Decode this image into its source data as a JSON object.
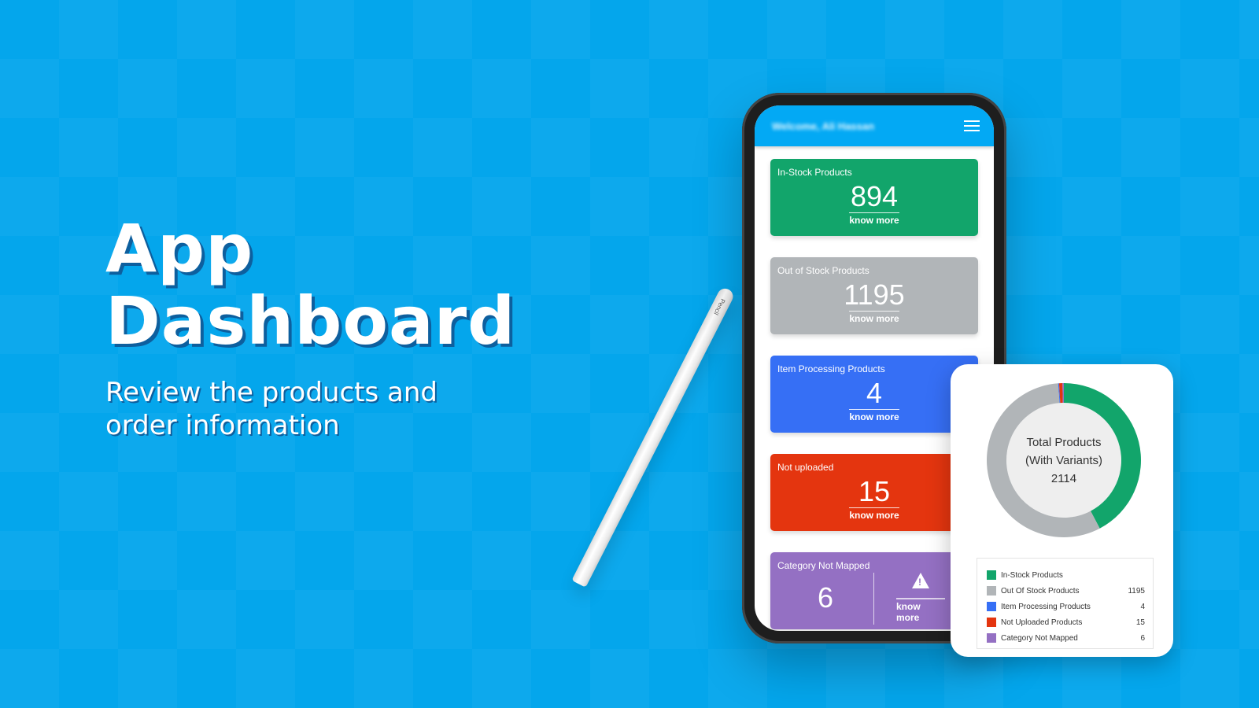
{
  "hero": {
    "title_line1": "App",
    "title_line2": "Dashboard",
    "subtitle_line1": "Review the products and",
    "subtitle_line2": "order information"
  },
  "pencil": {
    "label": "Pencil"
  },
  "app": {
    "header": {
      "welcome": "Welcome, Ali Hassan",
      "menu_icon": "hamburger-menu-icon",
      "color": "#03a9f4"
    },
    "cards": [
      {
        "title": "In-Stock Products",
        "value": "894",
        "link": "know more",
        "color": "#12a56b"
      },
      {
        "title": "Out of Stock Products",
        "value": "1195",
        "link": "know more",
        "color": "#b1b5b8"
      },
      {
        "title": "Item Processing Products",
        "value": "4",
        "link": "know more",
        "color": "#366ff5"
      },
      {
        "title": "Not uploaded",
        "value": "15",
        "link": "know more",
        "color": "#e4350f"
      },
      {
        "title": "Category Not Mapped",
        "value": "6",
        "link": "know more",
        "icon": "warning-icon",
        "color": "#9470c3"
      }
    ]
  },
  "chart_data": {
    "type": "pie",
    "title": "Total Products (With Variants)",
    "center_label_line1": "Total Products",
    "center_label_line2": "(With Variants)",
    "center_total": "2114",
    "categories": [
      "In-Stock Products",
      "Out Of Stock Products",
      "Item Processing Products",
      "Not Uploaded Products",
      "Category Not Mapped"
    ],
    "values": [
      894,
      1195,
      4,
      15,
      6
    ],
    "colors": [
      "#12a56b",
      "#b1b5b8",
      "#366ff5",
      "#e4350f",
      "#9470c3"
    ],
    "legend_values": [
      "",
      "1195",
      "4",
      "15",
      "6"
    ],
    "legend_position": "bottom",
    "donut": true
  }
}
